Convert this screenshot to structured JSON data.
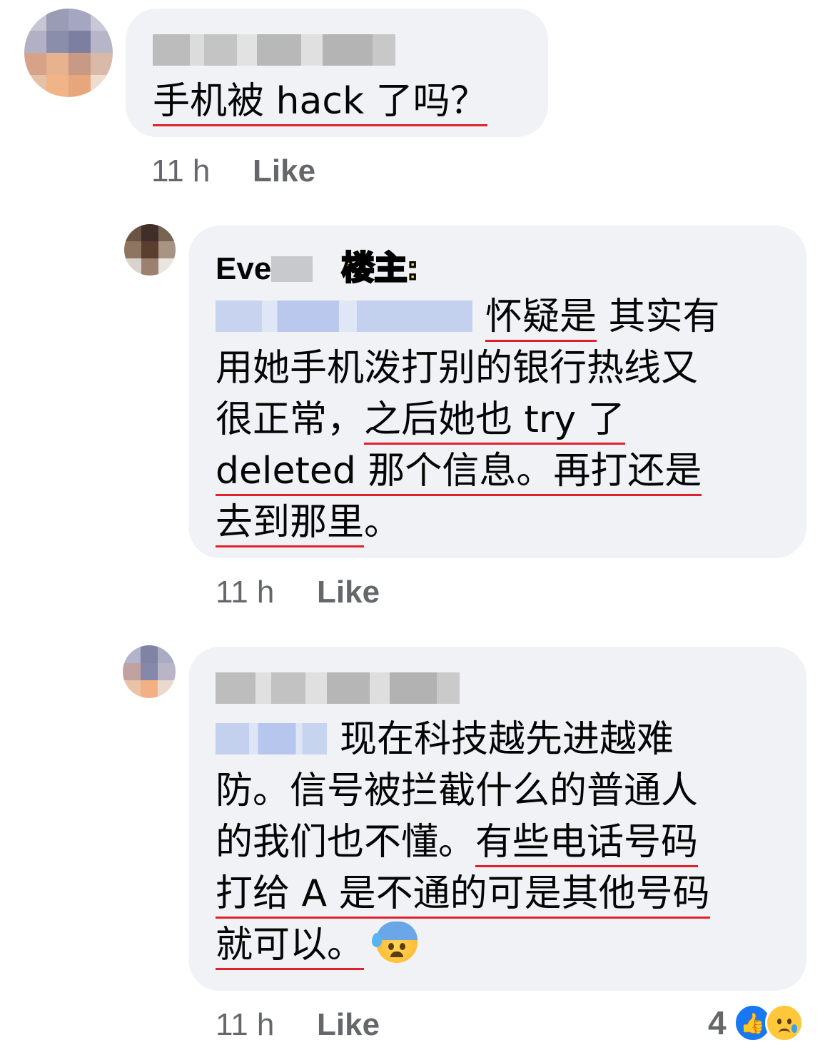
{
  "comments": [
    {
      "author": "",
      "lines": [
        [
          {
            "t": "手机被 hack 了吗？",
            "u": true
          }
        ]
      ],
      "time": "11 h",
      "like_label": "Like"
    },
    {
      "author": "Eve",
      "tag": "楼主:",
      "lines": [
        [
          {
            "t": "怀疑是",
            "u": true
          },
          {
            "t": " 其实有",
            "u": false
          }
        ],
        [
          {
            "t": "用她手机泼打别的银行热线又",
            "u": false
          }
        ],
        [
          {
            "t": "很正常，",
            "u": false
          },
          {
            "t": "之后她也 try 了",
            "u": true
          }
        ],
        [
          {
            "t": "deleted 那个信息。再打还是",
            "u": true
          }
        ],
        [
          {
            "t": "去到那里",
            "u": true
          },
          {
            "t": "。",
            "u": false
          }
        ]
      ],
      "time": "11 h",
      "like_label": "Like"
    },
    {
      "author": "",
      "lines": [
        [
          {
            "t": "现在科技越先进越难",
            "u": false
          }
        ],
        [
          {
            "t": "防。信号被拦截什么的普通人",
            "u": false
          }
        ],
        [
          {
            "t": "的我们也不懂。",
            "u": false
          },
          {
            "t": "有些电话号码",
            "u": true
          }
        ],
        [
          {
            "t": "打给 A 是不通的可是其他号码",
            "u": true
          }
        ],
        [
          {
            "t": "就可以。",
            "u": true
          }
        ]
      ],
      "emoji": "anxious-face-with-sweat",
      "time": "11 h",
      "like_label": "Like",
      "reaction_count": "4",
      "reactions": [
        "like",
        "sad"
      ]
    }
  ],
  "colors": {
    "underline": "#e0202a",
    "bubble": "#f0f2f5",
    "meta": "#65676b",
    "tag": "#fff200",
    "like_blue": "#1877f2"
  }
}
